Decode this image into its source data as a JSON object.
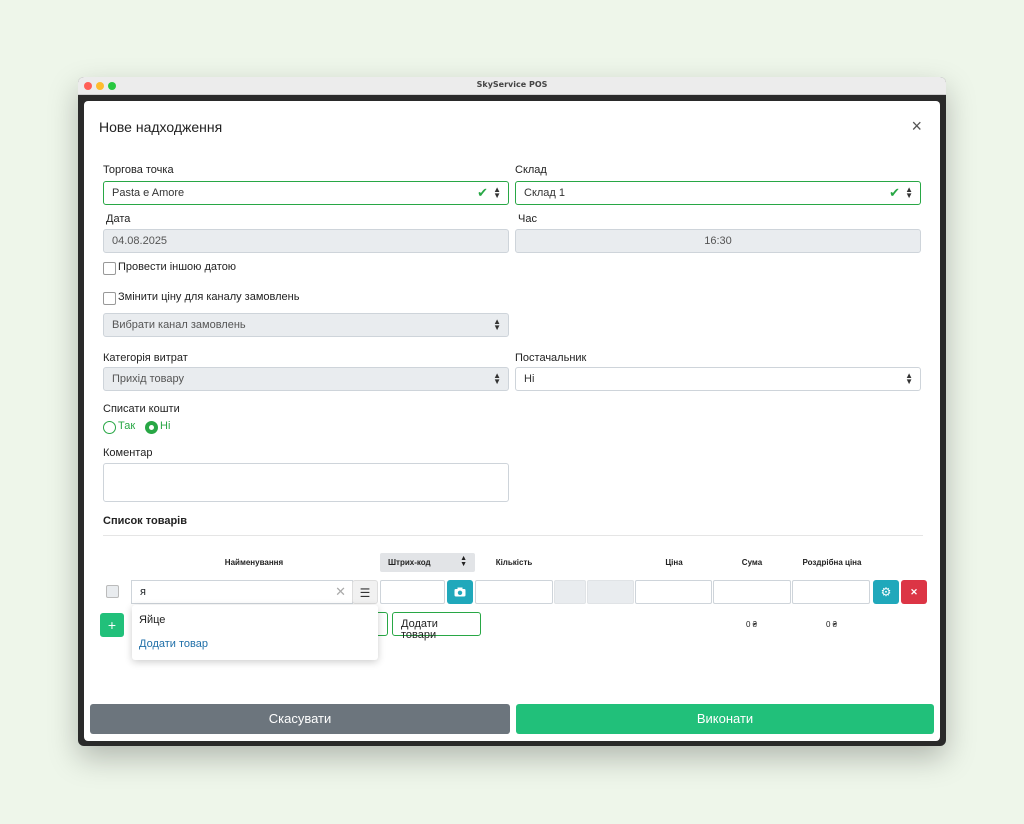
{
  "window": {
    "title": "SkyService POS"
  },
  "modal": {
    "title": "Нове надходження",
    "close_icon": "×"
  },
  "form": {
    "outlet": {
      "label": "Торгова точка",
      "value": "Pasta e Amore"
    },
    "warehouse": {
      "label": "Склад",
      "value": "Склад 1"
    },
    "date": {
      "label": "Дата",
      "value": "04.08.2025"
    },
    "time": {
      "label": "Час",
      "value": "16:30"
    },
    "other_date": {
      "label": "Провести іншою датою",
      "checked": false
    },
    "change_price": {
      "label": "Змінити ціну для каналу замовлень",
      "checked": false
    },
    "order_channel": {
      "placeholder": "Вибрати канал замовлень"
    },
    "expense_category": {
      "label": "Категорія витрат",
      "value": "Прихід товару"
    },
    "supplier": {
      "label": "Постачальник",
      "value": "Ні"
    },
    "write_off": {
      "label": "Списати кошти",
      "options": [
        "Так",
        "Ні"
      ],
      "selected": "Ні"
    },
    "comment": {
      "label": "Коментар",
      "value": ""
    }
  },
  "products": {
    "title": "Список товарів",
    "columns": {
      "name": "Найменування",
      "barcode": "Штрих-код",
      "quantity": "Кількість",
      "price": "Ціна",
      "sum": "Сума",
      "retail_price": "Роздрібна ціна"
    },
    "search_value": "я",
    "suggestions": [
      "Яйце",
      "Додати товар"
    ],
    "add_products_label": "Додати товари",
    "add_icon": "+",
    "sum_total": "0 ₴",
    "retail_total": "0 ₴"
  },
  "footer": {
    "cancel": "Скасувати",
    "submit": "Виконати"
  },
  "colors": {
    "green": "#28a745",
    "teal": "#20a8bb",
    "red": "#dc3545",
    "gray_button": "#6c757d",
    "submit": "#21c07a"
  }
}
